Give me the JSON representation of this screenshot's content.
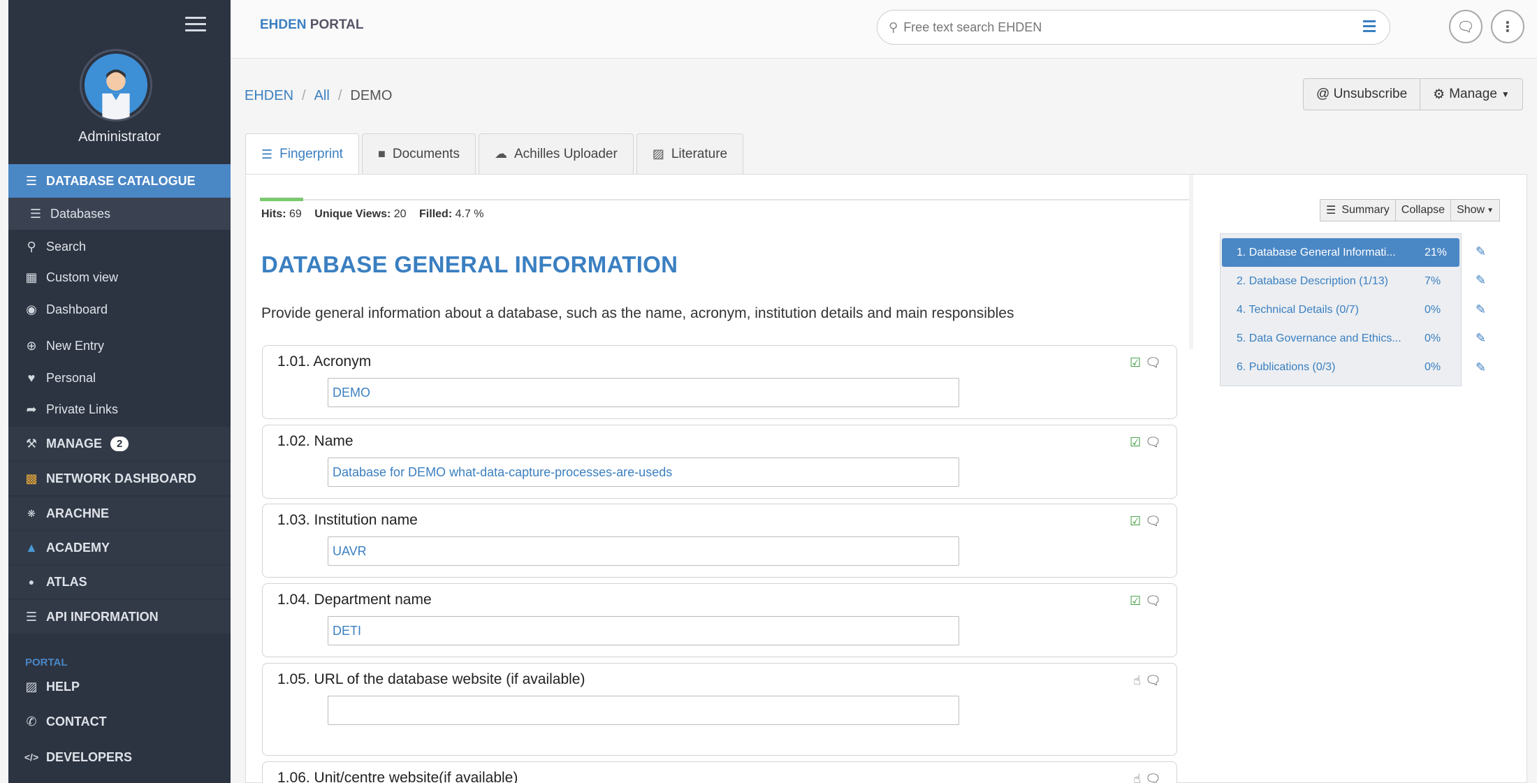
{
  "sidebar": {
    "admin_name": "Administrator",
    "items": [
      {
        "label": "DATABASE CATALOGUE",
        "icon": "database-icon"
      },
      {
        "label": "Databases",
        "icon": "list-icon"
      },
      {
        "label": "Search",
        "icon": "search-icon"
      },
      {
        "label": "Custom view",
        "icon": "grid-icon"
      },
      {
        "label": "Dashboard",
        "icon": "dashboard-icon"
      },
      {
        "label": "New Entry",
        "icon": "plus-circle-icon"
      },
      {
        "label": "Personal",
        "icon": "heart-icon"
      },
      {
        "label": "Private Links",
        "icon": "share-icon"
      },
      {
        "label": "MANAGE",
        "icon": "wrench-icon",
        "badge": "2"
      },
      {
        "label": "NETWORK DASHBOARD",
        "icon": "chart-icon"
      },
      {
        "label": "ARACHNE",
        "icon": "arachne-icon"
      },
      {
        "label": "ACADEMY",
        "icon": "graduation-cap-icon"
      },
      {
        "label": "ATLAS",
        "icon": "atlas-icon"
      },
      {
        "label": "API INFORMATION",
        "icon": "list-icon"
      },
      {
        "label": "HELP",
        "icon": "book-icon"
      },
      {
        "label": "CONTACT",
        "icon": "phone-icon"
      },
      {
        "label": "DEVELOPERS",
        "icon": "code-icon"
      }
    ],
    "portal_label": "PORTAL"
  },
  "header": {
    "brand_part1": "EHDEN",
    "brand_part2": "PORTAL",
    "search_placeholder": "Free text search EHDEN"
  },
  "breadcrumb": {
    "items": [
      "EHDEN",
      "All",
      "DEMO"
    ]
  },
  "actions": {
    "unsubscribe": "@ Unsubscribe",
    "manage": "Manage"
  },
  "tabs": [
    {
      "label": "Fingerprint",
      "icon": "list-icon"
    },
    {
      "label": "Documents",
      "icon": "folder-icon"
    },
    {
      "label": "Achilles Uploader",
      "icon": "cloud-upload-icon"
    },
    {
      "label": "Literature",
      "icon": "book-icon"
    }
  ],
  "stats": {
    "hits_label": "Hits:",
    "hits": "69",
    "views_label": "Unique Views:",
    "views": "20",
    "filled_label": "Filled:",
    "filled": "4.7 %",
    "filled_fraction": 0.047
  },
  "section": {
    "title": "DATABASE GENERAL INFORMATION",
    "description": "Provide general information about a database, such as the name, acronym, institution details and main responsibles"
  },
  "questions": [
    {
      "label": "1.01. Acronym",
      "value": "DEMO",
      "status": "checked"
    },
    {
      "label": "1.02. Name",
      "value": "Database for DEMO what-data-capture-processes-are-useds",
      "status": "checked"
    },
    {
      "label": "1.03. Institution name",
      "value": "UAVR",
      "status": "checked"
    },
    {
      "label": "1.04. Department name",
      "value": "DETI",
      "status": "checked"
    },
    {
      "label": "1.05. URL of the database website (if available)",
      "value": "",
      "status": "empty"
    },
    {
      "label": "1.06. Unit/centre website(if available)",
      "value": "",
      "status": "empty"
    }
  ],
  "summary": {
    "buttons": {
      "summary": "Summary",
      "collapse": "Collapse",
      "show": "Show"
    },
    "items": [
      {
        "label": "1. Database General Informati...",
        "pct": "21%"
      },
      {
        "label": "2. Database Description (1/13)",
        "pct": "7%"
      },
      {
        "label": "4. Technical Details (0/7)",
        "pct": "0%"
      },
      {
        "label": "5. Data Governance and Ethics...",
        "pct": "0%"
      },
      {
        "label": "6. Publications (0/3)",
        "pct": "0%"
      }
    ]
  },
  "colors": {
    "accent": "#3a7fc1",
    "sidebar_bg": "#2c3341",
    "active_item": "#4a87c5",
    "success": "#3a9a3a"
  }
}
